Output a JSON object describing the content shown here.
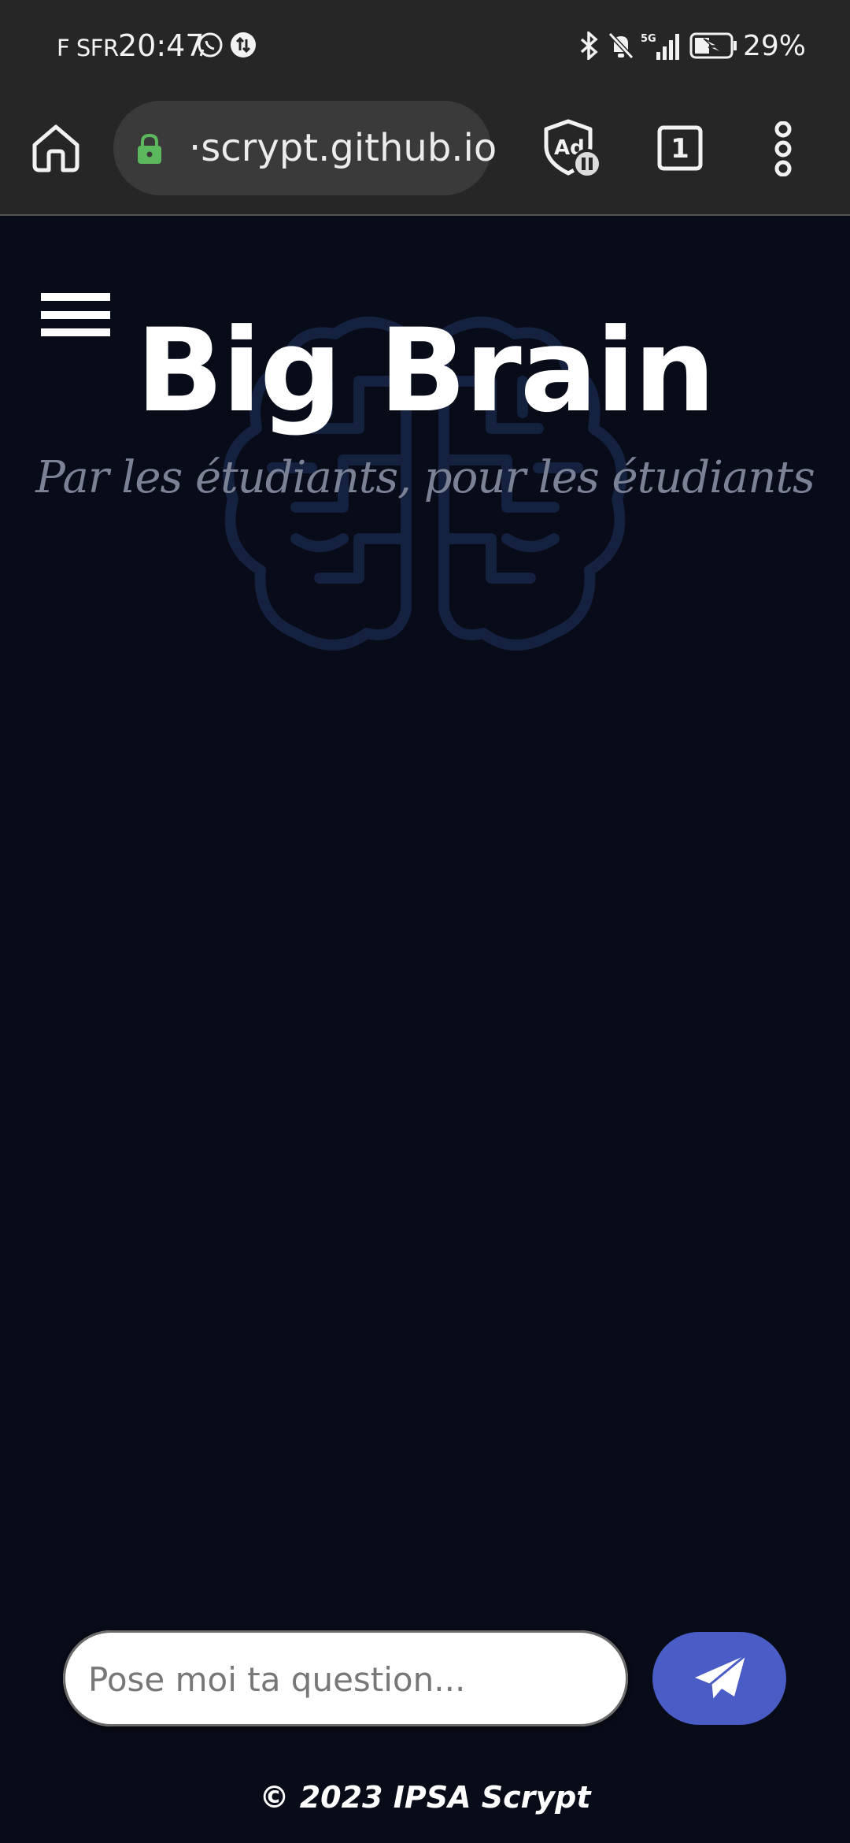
{
  "status_bar": {
    "carrier": "F SFR",
    "time": "20:47",
    "battery_percent": "29%",
    "icons": [
      "whatsapp-icon",
      "data-transfer-icon",
      "bluetooth-icon",
      "mute-icon",
      "5g-signal-icon",
      "battery-saver-icon"
    ]
  },
  "browser": {
    "url": "·scrypt.github.io",
    "tab_count": "1",
    "icons": [
      "home-icon",
      "lock-icon",
      "adblock-icon",
      "tabs-icon",
      "more-icon"
    ],
    "colors": {
      "lock": "#5cb85c",
      "toolbar": "#262626",
      "urlbar": "#3a3a3a"
    }
  },
  "page": {
    "title": "Big Brain",
    "subtitle": "Par les étudiants, pour les étudiants",
    "input_placeholder": "Pose moi ta question...",
    "footer": "© 2023 IPSA Scrypt",
    "colors": {
      "background": "#080b18",
      "accent": "#4a5cc5",
      "subtitle": "#7c8296",
      "logo": "#14213f"
    }
  }
}
